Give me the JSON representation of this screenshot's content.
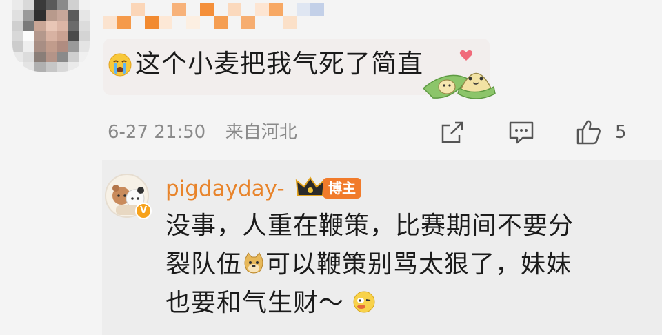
{
  "comment": {
    "text": "这个小麦把我气死了简直",
    "emoji_icon": "crying-face-icon",
    "sticker_icon": "zongzi-heart-sticker",
    "date": "6-27 21:50",
    "location": "来自河北",
    "like_count": "5"
  },
  "reply": {
    "username": "pigdayday-",
    "badge": "博主",
    "line1": "没事，人重在鞭策，比赛期间不要分",
    "line2_a": "裂队伍",
    "line2_b": "可以鞭策别骂太狠了，妹妹",
    "line3": "也要和气生财～",
    "emoji_1": "doge-face-icon",
    "emoji_2": "wink-face-icon"
  },
  "colors": {
    "username": "#e8842b",
    "badge_bg": "#f17b2b",
    "meta_text": "#8a8a8a"
  }
}
